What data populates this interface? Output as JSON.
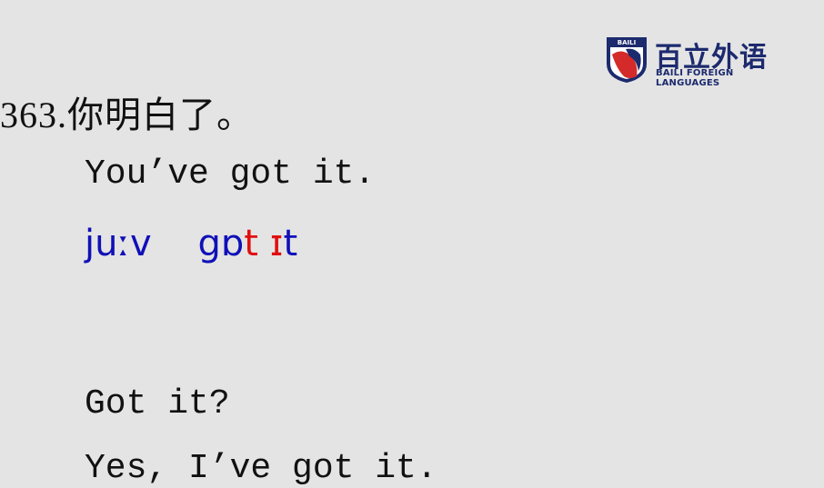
{
  "logo": {
    "badge_text": "BAILI",
    "name_cn": "百立外语",
    "name_en": "BAILI FOREIGN LANGUAGES",
    "colors": {
      "navy": "#1c2a6e",
      "red": "#d42a2a"
    }
  },
  "lesson": {
    "number": "363.",
    "chinese": "你明白了。",
    "english": "You’ve got it.",
    "phonetic": [
      {
        "text": "juːv",
        "color": "blue"
      },
      {
        "text": "    ",
        "color": "blue"
      },
      {
        "text": "gɒ",
        "color": "blue"
      },
      {
        "text": "t",
        "color": "red"
      },
      {
        "text": " ",
        "color": "blue"
      },
      {
        "text": "ɪ",
        "color": "red"
      },
      {
        "text": "t",
        "color": "blue"
      }
    ],
    "variant_1": "Got it?",
    "variant_2": "Yes, I’ve got it."
  },
  "colors": {
    "phonetic_blue": "#1010b8",
    "phonetic_red": "#e01010",
    "background": "#e4e4e4"
  }
}
